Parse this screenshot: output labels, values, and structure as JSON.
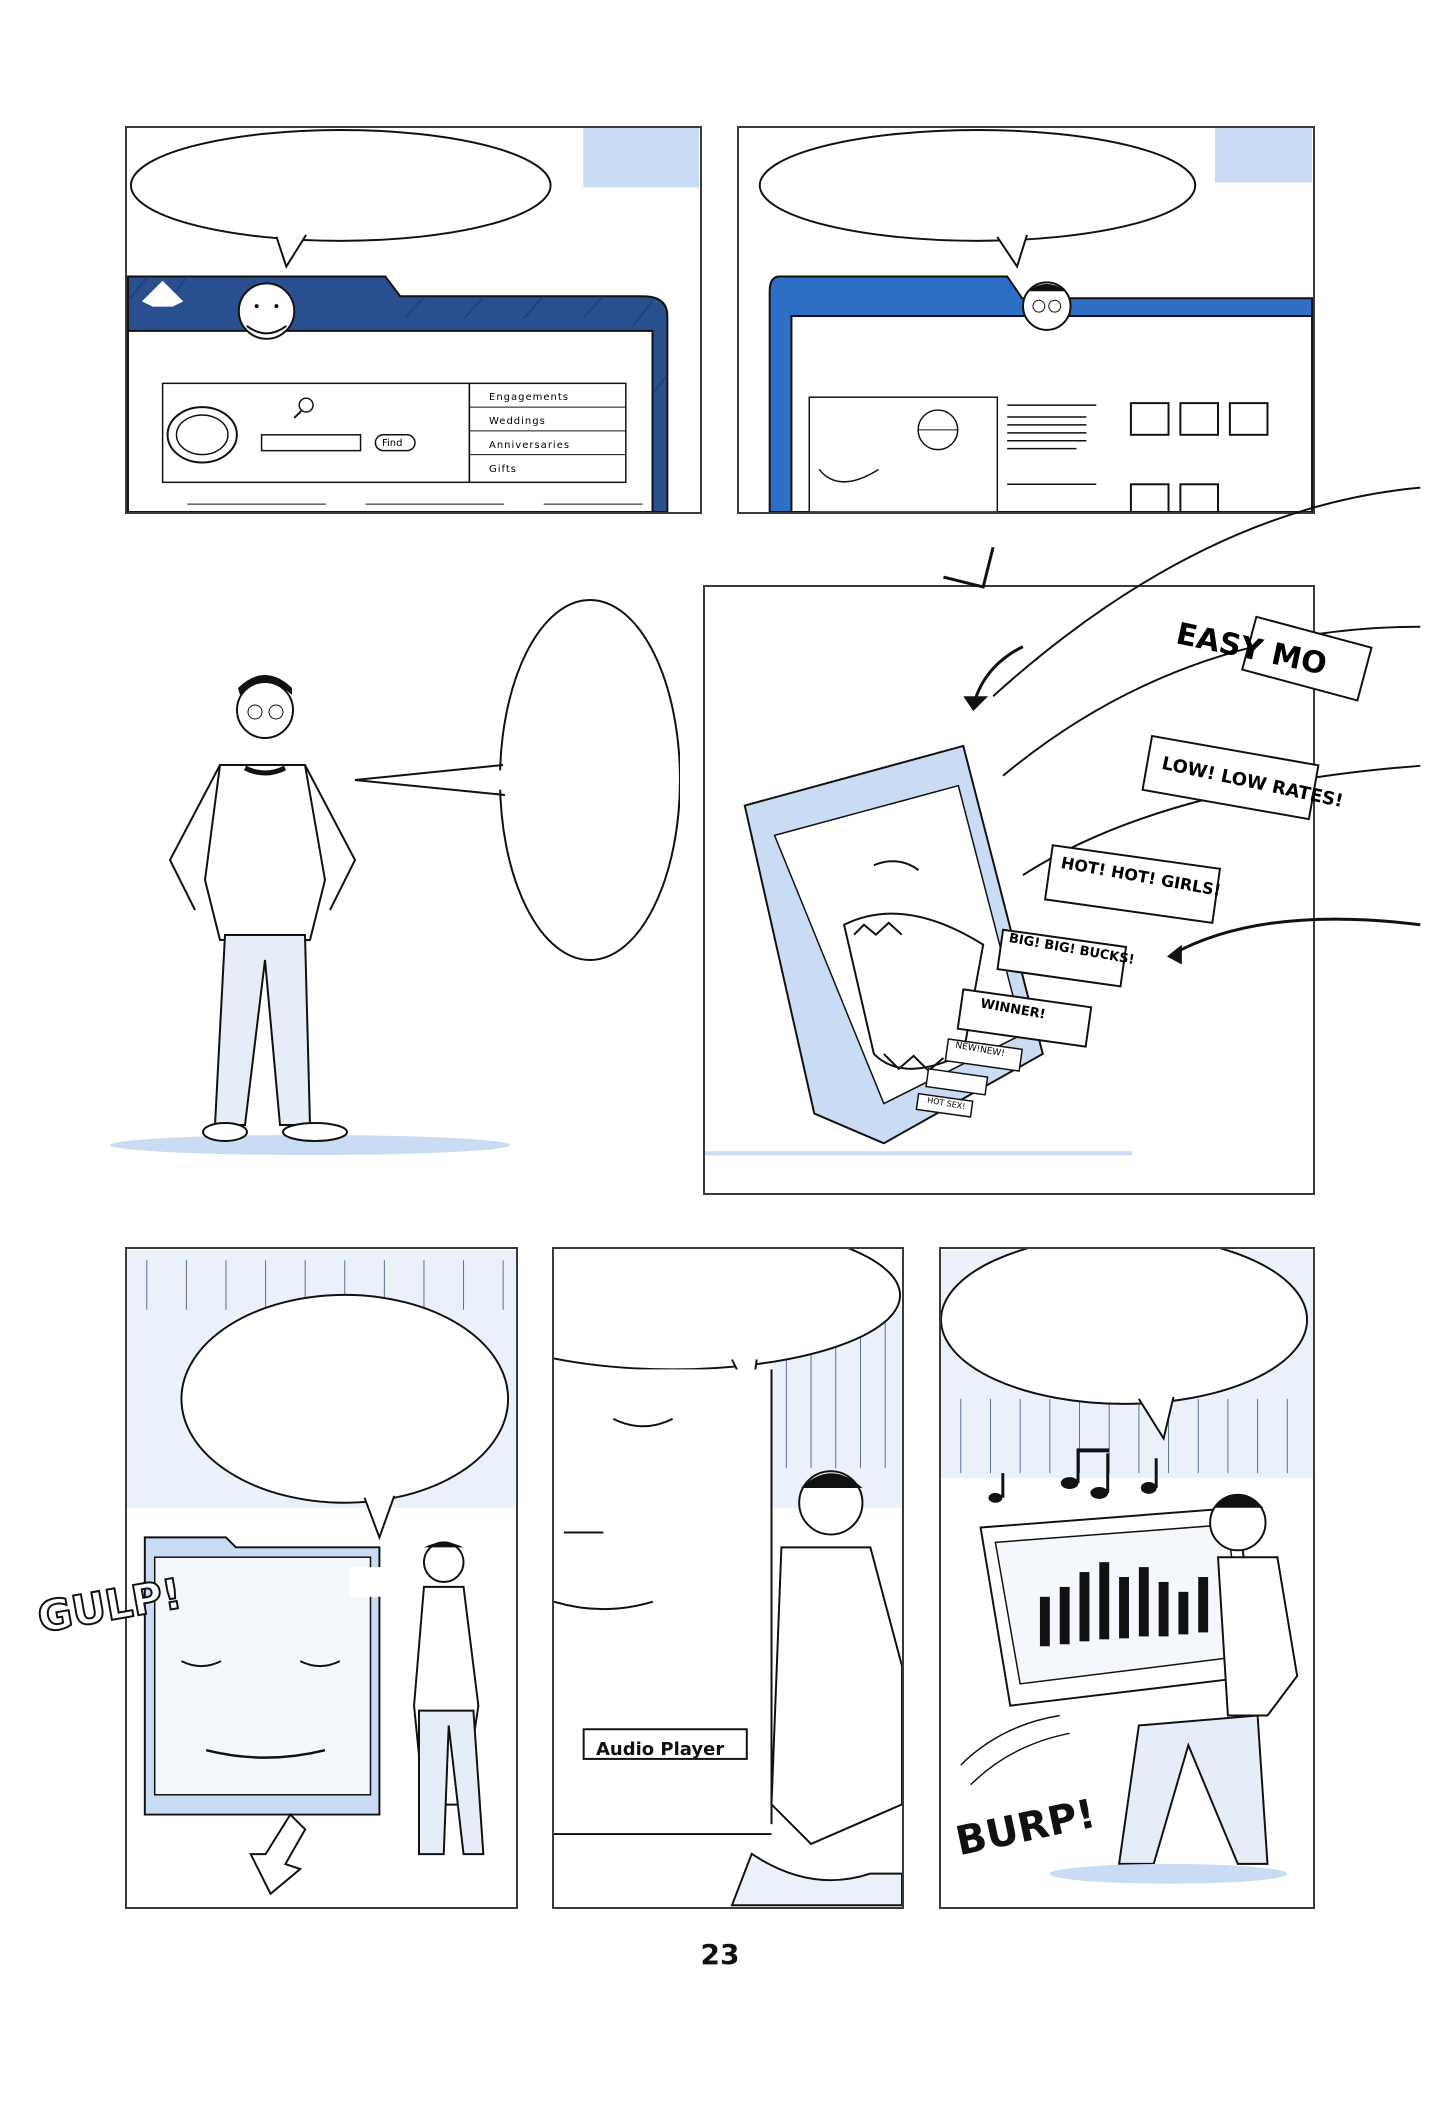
{
  "page": {
    "number": "23"
  },
  "panels": {
    "p1": {
      "menu_items": [
        "Engagements",
        "Weddings",
        "Anniversaries",
        "Gifts"
      ],
      "search_button": "Find"
    },
    "p4": {
      "spam_labels": [
        "EASY MO",
        "LOW! LOW RATES!",
        "HOT! HOT! GIRLS!",
        "BIG! BIG! BUCKS!",
        "WINNER!",
        "NEW!NEW!",
        "HOT SEX!"
      ]
    },
    "p6": {
      "widget_label": "Audio Player"
    },
    "p5": {
      "sfx": "GULP!"
    },
    "p7": {
      "sfx": "BURP!"
    }
  },
  "colors": {
    "accent_blue": "#c9dcf3",
    "deep_blue": "#2a4f8f",
    "bright_blue": "#2d6fc4",
    "ink": "#1a1a1a"
  }
}
